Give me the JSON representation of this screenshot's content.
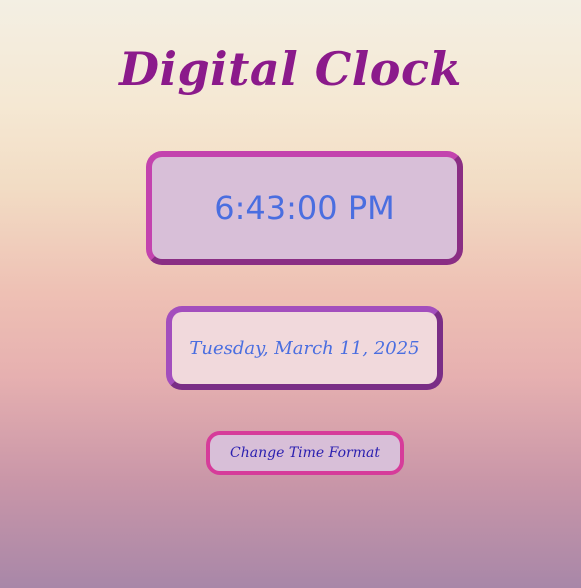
{
  "page": {
    "title": "Digital Clock"
  },
  "clock": {
    "time": "6:43:00 PM",
    "date": "Tuesday, March 11, 2025"
  },
  "controls": {
    "format_button_label": "Change Time Format"
  },
  "colors": {
    "title": "#8b1a8b",
    "clock_text": "#4a6ee0",
    "time_border": "#c343ae",
    "date_border": "#7a2e86",
    "button_border": "#d63c9a",
    "button_text": "#2a1fb0"
  }
}
